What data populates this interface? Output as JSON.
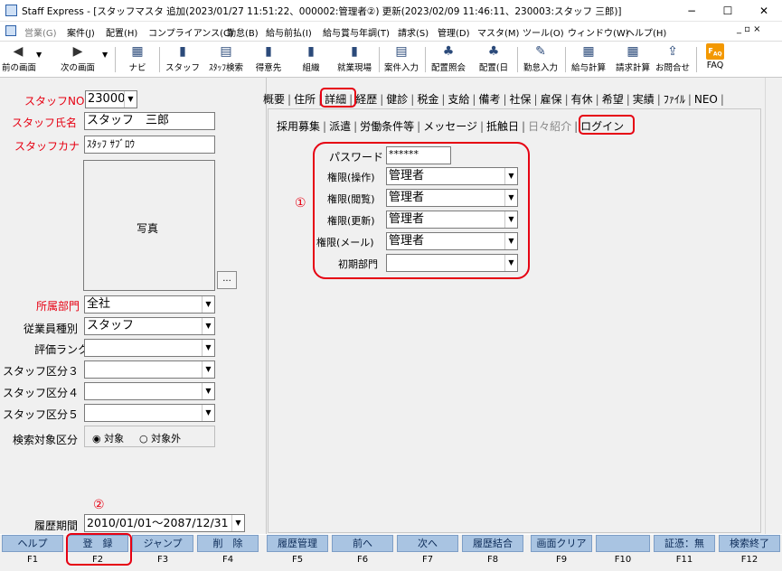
{
  "window": {
    "title": "Staff Express - [スタッフマスタ 追加(2023/01/27 11:51:22、000002:管理者②) 更新(2023/02/09 11:46:11、230003:スタッフ 三郎)]",
    "minimize": "−",
    "maximize": "☐",
    "close": "✕"
  },
  "menu": {
    "items": [
      "営業(G)",
      "案件(J)",
      "配置(H)",
      "コンプライアンス(C)",
      "勤怠(B)",
      "給与前払(I)",
      "給与賞与年調(T)",
      "請求(S)",
      "管理(D)",
      "マスタ(M)",
      "ツール(O)",
      "ウィンドウ(W)",
      "ヘルプ(H)"
    ],
    "mdi_controls": "_ ▫ ×"
  },
  "toolbar": [
    {
      "label": "前の画面",
      "icon": "back-arrow-icon",
      "glyph": "◀"
    },
    {
      "label": "次の画面",
      "icon": "forward-arrow-icon",
      "glyph": "▶"
    },
    {
      "label": "ナビ",
      "icon": "navi-icon",
      "glyph": "▦"
    },
    {
      "label": "スタッフ",
      "icon": "staff-icon",
      "glyph": "▮"
    },
    {
      "label": "ｽﾀｯﾌ検索",
      "icon": "staff-search-icon",
      "glyph": "▤"
    },
    {
      "label": "得意先",
      "icon": "client-icon",
      "glyph": "▮"
    },
    {
      "label": "組織",
      "icon": "organization-icon",
      "glyph": "▮"
    },
    {
      "label": "就業現場",
      "icon": "workplace-icon",
      "glyph": "▮"
    },
    {
      "label": "案件入力",
      "icon": "job-entry-icon",
      "glyph": "▤"
    },
    {
      "label": "配置照会",
      "icon": "placement-inquiry-icon",
      "glyph": "♣"
    },
    {
      "label": "配置(日",
      "icon": "placement-daily-icon",
      "glyph": "♣"
    },
    {
      "label": "勤怠入力",
      "icon": "attendance-entry-icon",
      "glyph": "✎"
    },
    {
      "label": "給与計算",
      "icon": "payroll-icon",
      "glyph": "▦"
    },
    {
      "label": "請求計算",
      "icon": "billing-icon",
      "glyph": "▦"
    },
    {
      "label": "お問合せ",
      "icon": "inquiry-icon",
      "glyph": "⇪"
    },
    {
      "label": "FAQ",
      "icon": "faq-icon",
      "glyph": "FAQ"
    }
  ],
  "left": {
    "staff_no_label": "スタッフNO",
    "staff_no_value": "230003",
    "staff_name_label": "スタッフ氏名",
    "staff_name_value": "スタッフ　三郎",
    "staff_kana_label": "スタッフカナ",
    "staff_kana_value": "ｽﾀｯﾌ ｻﾌﾞﾛｳ",
    "photo_label": "写真",
    "photo_button": "...",
    "department_label": "所属部門",
    "department_value": "全社",
    "employee_type_label": "従業員種別",
    "employee_type_value": "スタッフ",
    "rank_label": "評価ランク",
    "rank_value": "",
    "category3_label": "スタッフ区分３",
    "category3_value": "",
    "category4_label": "スタッフ区分４",
    "category4_value": "",
    "category5_label": "スタッフ区分５",
    "category5_value": "",
    "search_target_label": "検索対象区分",
    "radio_target": "対象",
    "radio_exclude": "対象外",
    "history_label": "履歴期間",
    "history_value": "2010/01/01～2087/12/31",
    "annotation_2": "②"
  },
  "tabs_main": [
    "概要",
    "住所",
    "詳細",
    "経歴",
    "健診",
    "税金",
    "支給",
    "備考",
    "社保",
    "雇保",
    "有休",
    "希望",
    "実績",
    "ﾌｧｲﾙ",
    "NEO"
  ],
  "tabs_sub": [
    "採用募集",
    "派遣",
    "労働条件等",
    "メッセージ",
    "抵触日",
    "日々紹介",
    "ログイン"
  ],
  "login": {
    "annotation_1": "①",
    "password_label": "パスワード",
    "password_value": "******",
    "perm_operation_label": "権限(操作)",
    "perm_operation_value": "管理者",
    "perm_view_label": "権限(閲覧)",
    "perm_view_value": "管理者",
    "perm_update_label": "権限(更新)",
    "perm_update_value": "管理者",
    "perm_mail_label": "権限(メール)",
    "perm_mail_value": "管理者",
    "initial_dept_label": "初期部門",
    "initial_dept_value": ""
  },
  "fkeys": [
    {
      "label": "ヘルプ",
      "key": "F1"
    },
    {
      "label": "登　録",
      "key": "F2"
    },
    {
      "label": "ジャンプ",
      "key": "F3"
    },
    {
      "label": "削　除",
      "key": "F4"
    },
    {
      "label": "履歴管理",
      "key": "F5"
    },
    {
      "label": "前へ",
      "key": "F6"
    },
    {
      "label": "次へ",
      "key": "F7"
    },
    {
      "label": "履歴結合",
      "key": "F8"
    },
    {
      "label": "画面クリア",
      "key": "F9"
    },
    {
      "label": "",
      "key": "F10"
    },
    {
      "label": "証憑：無",
      "key": "F11"
    },
    {
      "label": "検索終了",
      "key": "F12"
    }
  ],
  "colors": {
    "required_label": "#e60012",
    "annotation": "#e60012",
    "fkey_button": "#a9c4e2"
  }
}
